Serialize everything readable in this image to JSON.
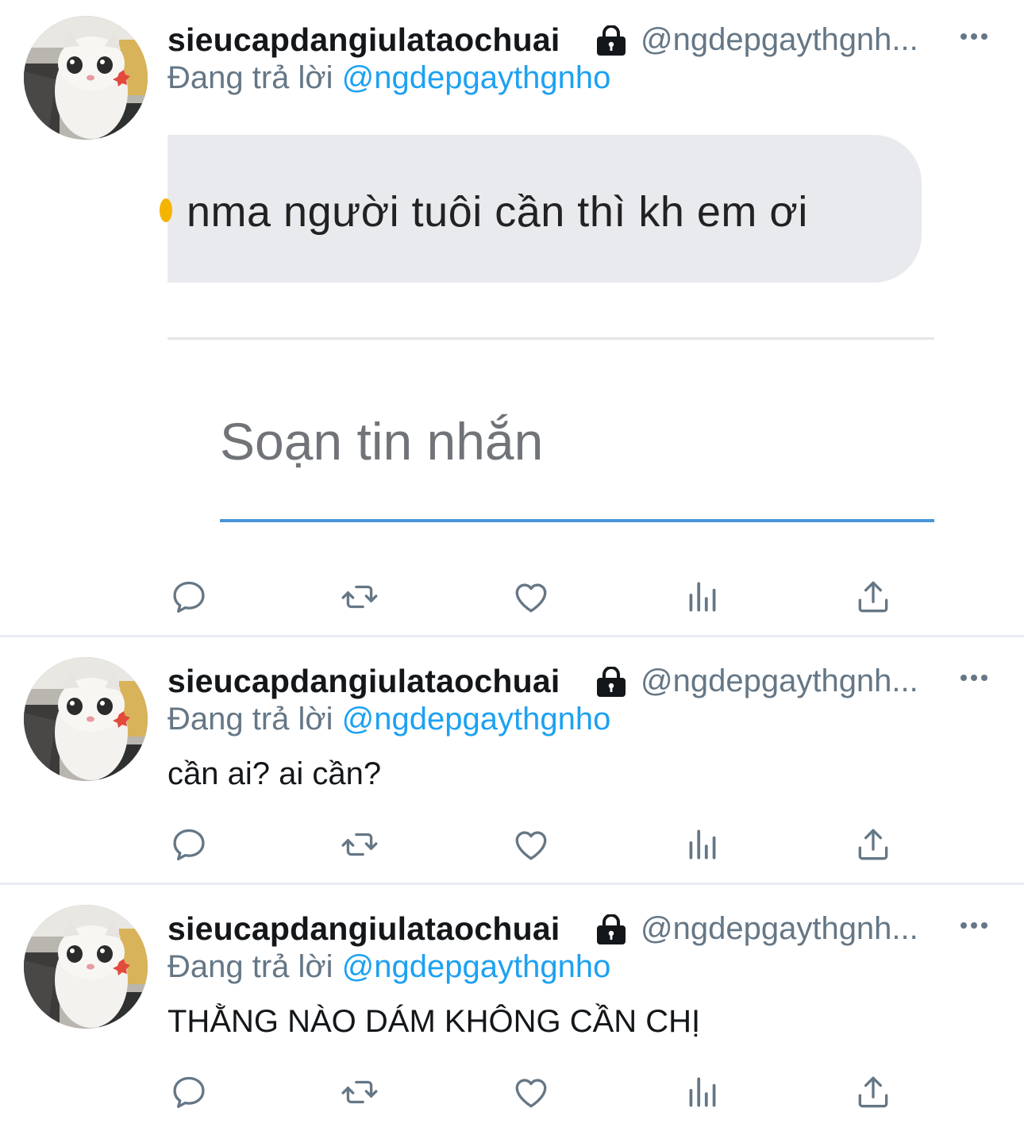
{
  "tweets": [
    {
      "display_name": "sieucapdangiulataochuai",
      "handle": "@ngdepgaythgnh...",
      "reply_prefix": "Đang trả lời",
      "reply_to": "@ngdepgaythgnho",
      "embedded_image": {
        "message_bubble_text": "nma người tuôi cần thì kh em ơi",
        "compose_placeholder": "Soạn tin nhắn"
      }
    },
    {
      "display_name": "sieucapdangiulataochuai",
      "handle": "@ngdepgaythgnh...",
      "reply_prefix": "Đang trả lời",
      "reply_to": "@ngdepgaythgnho",
      "text": "cần ai? ai cần?"
    },
    {
      "display_name": "sieucapdangiulataochuai",
      "handle": "@ngdepgaythgnh...",
      "reply_prefix": "Đang trả lời",
      "reply_to": "@ngdepgaythgnho",
      "text": "THẰNG NÀO DÁM KHÔNG CẦN CHỊ"
    }
  ],
  "icons": [
    "protected-lock-icon",
    "more-icon",
    "reply-icon",
    "retweet-icon",
    "like-icon",
    "analytics-icon",
    "share-icon"
  ],
  "colors": {
    "text": "#14171a",
    "secondary": "#657786",
    "link": "#1da1f2",
    "divider": "#e8ebef",
    "icon": "#657786"
  }
}
